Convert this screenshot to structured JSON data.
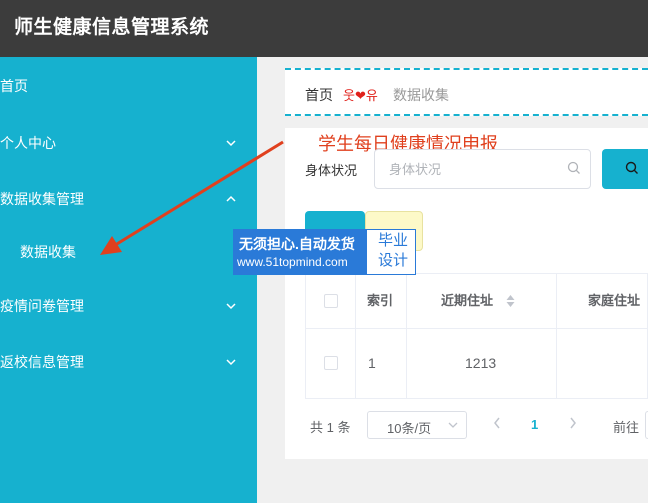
{
  "app": {
    "title": "师生健康信息管理系统"
  },
  "sidebar": {
    "items": [
      {
        "label": "首页",
        "has_chevron": false
      },
      {
        "label": "个人中心",
        "has_chevron": true,
        "chevron": "down"
      },
      {
        "label": "数据收集管理",
        "has_chevron": true,
        "chevron": "up",
        "expanded": true
      },
      {
        "label": "数据收集",
        "submenu": true
      },
      {
        "label": "疫情问卷管理",
        "has_chevron": true,
        "chevron": "down"
      },
      {
        "label": "返校信息管理",
        "has_chevron": true,
        "chevron": "down"
      }
    ]
  },
  "breadcrumb": {
    "home": "首页",
    "separator": "웃❤유",
    "current": "数据收集"
  },
  "annotation": {
    "text": "学生每日健康情况申报"
  },
  "search": {
    "label": "身体状况",
    "placeholder": "身体状况"
  },
  "watermark": {
    "line1": "无须担心.自动发货",
    "line2": "www.51topmind.com",
    "right_line1": "毕业",
    "right_line2": "设计"
  },
  "table": {
    "headers": {
      "index": "索引",
      "recent_address": "近期住址",
      "home_address": "家庭住址"
    },
    "rows": [
      {
        "index": "1",
        "recent_address": "1213"
      }
    ]
  },
  "pagination": {
    "total": "共 1 条",
    "page_size": "10条/页",
    "current_page": "1",
    "goto": "前往"
  },
  "colors": {
    "accent": "#16b1cf",
    "header_bg": "#3c3c3c",
    "annotation": "#e0401e",
    "watermark": "#2a7ad8"
  }
}
